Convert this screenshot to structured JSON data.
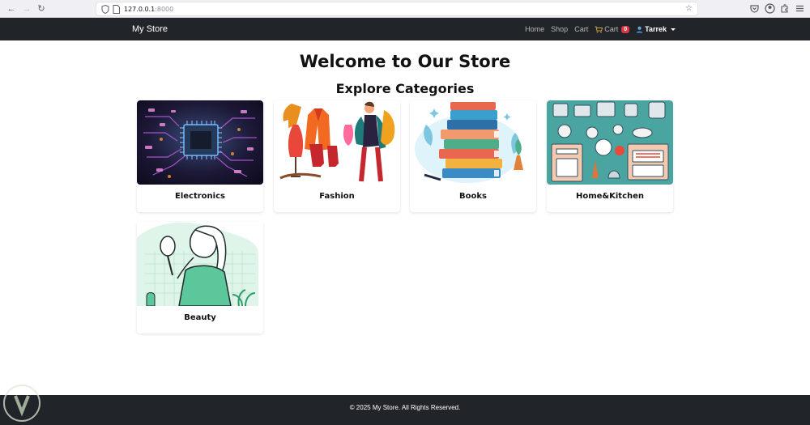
{
  "browser": {
    "url_host": "127.0.0.1",
    "url_port": ":8000"
  },
  "navbar": {
    "brand": "My Store",
    "links": {
      "home": "Home",
      "shop": "Shop",
      "cart": "Cart",
      "cart_icon_label": "Cart",
      "cart_count": "0",
      "user": "Tarrek"
    },
    "colors": {
      "background": "#212529",
      "badge": "#dc3545"
    }
  },
  "main": {
    "title": "Welcome to Our Store",
    "subtitle": "Explore Categories",
    "categories": [
      {
        "name": "Electronics",
        "image": "circuit-board-image"
      },
      {
        "name": "Fashion",
        "image": "clothing-illustration"
      },
      {
        "name": "Books",
        "image": "book-stack-illustration"
      },
      {
        "name": "Home&Kitchen",
        "image": "kitchen-illustration"
      },
      {
        "name": "Beauty",
        "image": "skincare-illustration"
      }
    ]
  },
  "footer": {
    "copyright": "© 2025 My Store. All Rights Reserved."
  }
}
